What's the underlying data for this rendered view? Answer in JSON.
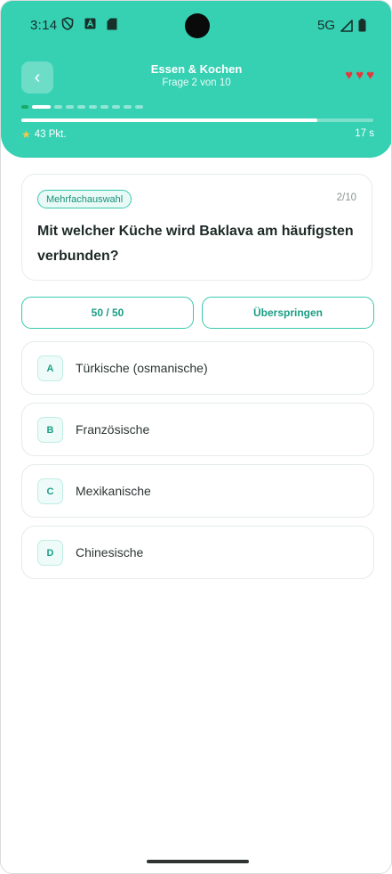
{
  "status_bar": {
    "time": "3:14",
    "network": "5G",
    "icons": [
      "shield-icon",
      "text-box-icon",
      "sd-card-icon",
      "signal-icon",
      "battery-icon"
    ]
  },
  "header": {
    "back_glyph": "‹",
    "title": "Essen & Kochen",
    "subtitle": "Frage 2 von 10",
    "hearts": [
      "♥",
      "♥",
      "♥"
    ],
    "points": "43 Pkt.",
    "timer": "17 s",
    "question_dots": [
      "done",
      "current",
      "todo",
      "todo",
      "todo",
      "todo",
      "todo",
      "todo",
      "todo",
      "todo"
    ],
    "timer_progress": 0.84
  },
  "question": {
    "badge": "Mehrfachauswahl",
    "counter": "2/10",
    "text": "Mit welcher Küche wird Baklava am häufigsten verbunden?"
  },
  "jokers": {
    "fifty": "50 / 50",
    "skip": "Überspringen"
  },
  "answers": [
    {
      "letter": "A",
      "label": "Türkische (osmanische)"
    },
    {
      "letter": "B",
      "label": "Französische"
    },
    {
      "letter": "C",
      "label": "Mexikanische"
    },
    {
      "letter": "D",
      "label": "Chinesische"
    }
  ],
  "colors": {
    "accent": "#36d0b3",
    "heart": "#e3383b",
    "star": "#f2c94c"
  }
}
